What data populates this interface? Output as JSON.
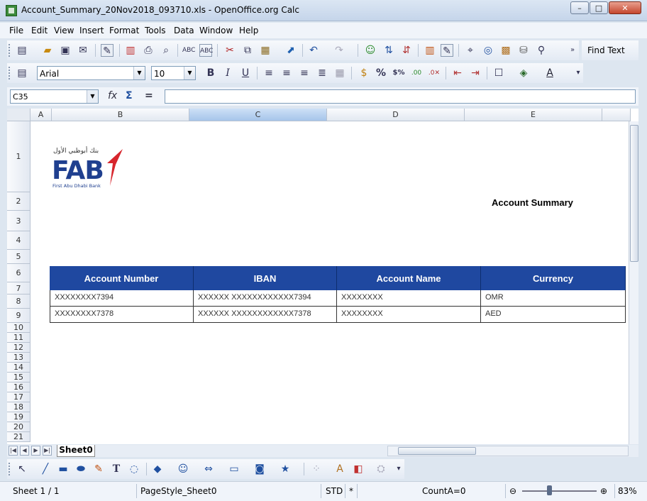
{
  "window": {
    "title": "Account_Summary_20Nov2018_093710.xls - OpenOffice.org Calc",
    "min_glyph": "–",
    "max_glyph": "□",
    "close_glyph": "✕"
  },
  "menu": [
    "File",
    "Edit",
    "View",
    "Insert",
    "Format",
    "Tools",
    "Data",
    "Window",
    "Help"
  ],
  "toolbar": {
    "find_text_label": "Find Text",
    "font_name": "Arial",
    "font_size": "10"
  },
  "formula_bar": {
    "name_box": "C35",
    "fx_glyph": "fx",
    "sum_glyph": "Σ",
    "equals_glyph": "=",
    "formula": ""
  },
  "columns": [
    "A",
    "B",
    "C",
    "D",
    "E"
  ],
  "rows": [
    "1",
    "2",
    "3",
    "4",
    "5",
    "6",
    "7",
    "8",
    "9",
    "10",
    "11",
    "12",
    "13",
    "14",
    "15",
    "16",
    "17",
    "18",
    "19",
    "20",
    "21"
  ],
  "logo": {
    "arabic": "بنك أبوظبي الأول",
    "letters": "FAB",
    "subtitle": "First Abu Dhabi Bank"
  },
  "report_title": "Account Summary",
  "table": {
    "headers": [
      "Account Number",
      "IBAN",
      "Account Name",
      "Currency"
    ],
    "rows": [
      [
        "XXXXXXXX7394",
        "XXXXXX XXXXXXXXXXXX7394",
        "XXXXXXXX",
        "OMR"
      ],
      [
        "XXXXXXXX7378",
        "XXXXXX XXXXXXXXXXXX7378",
        "XXXXXXXX",
        "AED"
      ]
    ]
  },
  "sheet_tab": "Sheet0",
  "status": {
    "sheet": "Sheet 1 / 1",
    "page_style": "PageStyle_Sheet0",
    "mode": "STD",
    "modified": "*",
    "count": "CountA=0",
    "zoom": "83%"
  },
  "colors": {
    "table_header_bg": "#1f48a0",
    "logo_blue": "#1f3f8f",
    "logo_red": "#d7262d",
    "selected_column": "#a6c5ea"
  }
}
